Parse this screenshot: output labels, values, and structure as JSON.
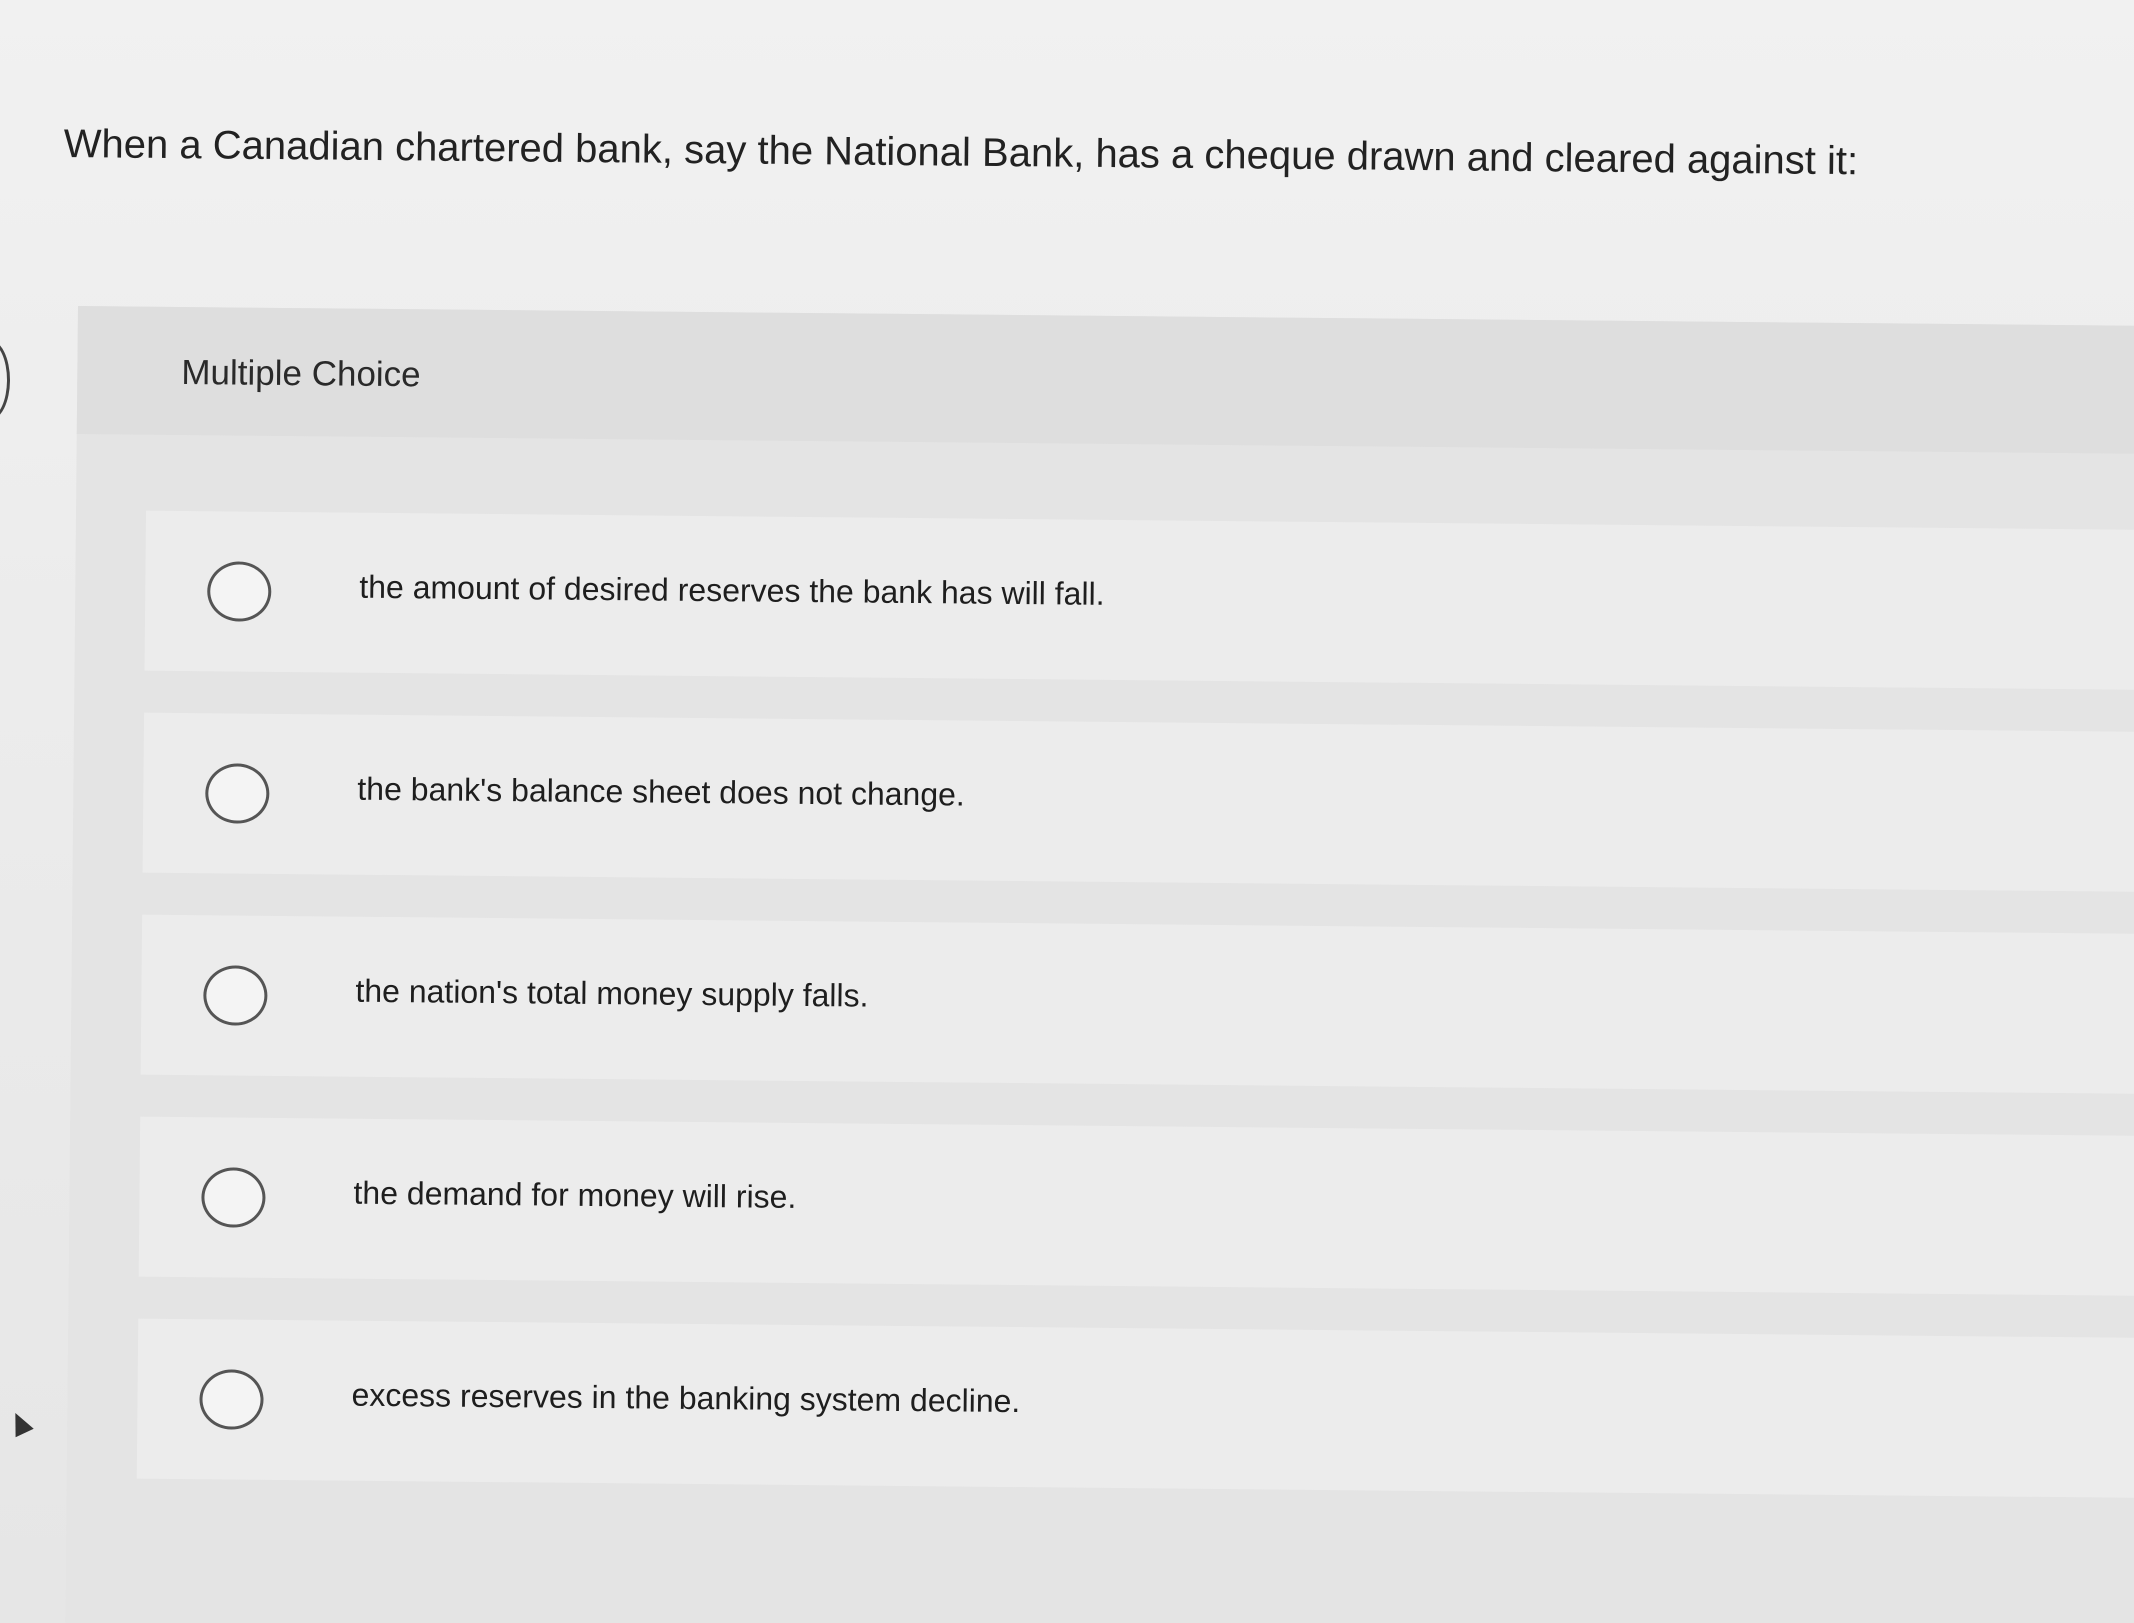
{
  "question": {
    "text": "When a Canadian chartered bank, say the National Bank, has a cheque drawn and cleared against it:"
  },
  "panel": {
    "type_label": "Multiple Choice"
  },
  "choices": [
    {
      "text": "the amount of desired reserves the bank has will fall."
    },
    {
      "text": "the bank's balance sheet does not change."
    },
    {
      "text": "the nation's total money supply falls."
    },
    {
      "text": "the demand for money will rise."
    },
    {
      "text": "excess reserves in the banking system decline."
    }
  ]
}
